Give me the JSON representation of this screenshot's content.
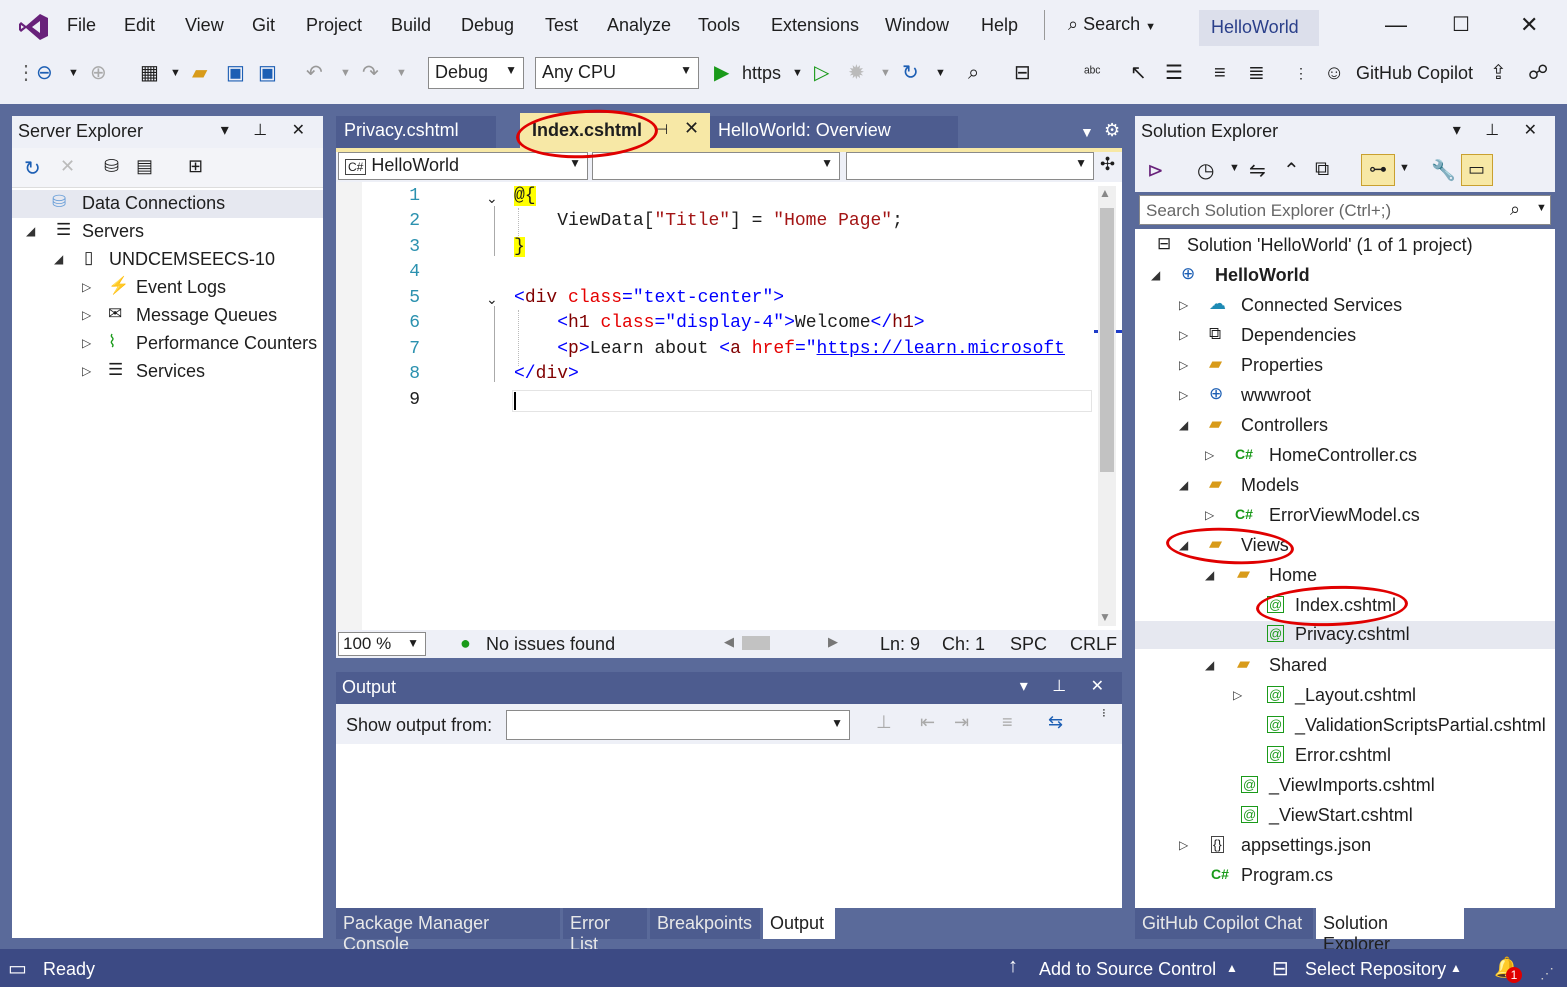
{
  "menu": [
    "File",
    "Edit",
    "View",
    "Git",
    "Project",
    "Build",
    "Debug",
    "Test",
    "Analyze",
    "Tools",
    "Extensions",
    "Window",
    "Help"
  ],
  "search_label": "Search",
  "solution_name": "HelloWorld",
  "toolbar": {
    "config": "Debug",
    "platform": "Any CPU",
    "run_target": "https",
    "copilot": "GitHub Copilot"
  },
  "server_explorer": {
    "title": "Server Explorer",
    "items": [
      "Data Connections",
      "Servers",
      "UNDCEMSEECS-10",
      "Event Logs",
      "Message Queues",
      "Performance Counters",
      "Services"
    ]
  },
  "editor": {
    "tabs": [
      "Privacy.cshtml",
      "Index.cshtml",
      "HelloWorld: Overview"
    ],
    "nav_project": "HelloWorld",
    "line_numbers": [
      "1",
      "2",
      "3",
      "4",
      "5",
      "6",
      "7",
      "8",
      "9"
    ],
    "zoom": "100 %",
    "issues": "No issues found",
    "ln": "Ln: 9",
    "ch": "Ch: 1",
    "spc": "SPC",
    "crlf": "CRLF"
  },
  "output": {
    "title": "Output",
    "show_from": "Show output from:"
  },
  "bottom_tabs": [
    "Package Manager Console",
    "Error List",
    "Breakpoints",
    "Output"
  ],
  "solution_explorer": {
    "title": "Solution Explorer",
    "search_placeholder": "Search Solution Explorer (Ctrl+;)",
    "items": [
      "Solution 'HelloWorld' (1 of 1 project)",
      "HelloWorld",
      "Connected Services",
      "Dependencies",
      "Properties",
      "wwwroot",
      "Controllers",
      "HomeController.cs",
      "Models",
      "ErrorViewModel.cs",
      "Views",
      "Home",
      "Index.cshtml",
      "Privacy.cshtml",
      "Shared",
      "_Layout.cshtml",
      "_ValidationScriptsPartial.cshtml",
      "Error.cshtml",
      "_ViewImports.cshtml",
      "_ViewStart.cshtml",
      "appsettings.json",
      "Program.cs"
    ]
  },
  "right_tabs": [
    "GitHub Copilot Chat",
    "Solution Explorer"
  ],
  "status": {
    "ready": "Ready",
    "source_control": "Add to Source Control",
    "repo": "Select Repository",
    "notif_count": "1"
  },
  "colors": {
    "accent": "#68217a",
    "status_bar": "#3c4a84",
    "highlight_red": "#e00000"
  }
}
